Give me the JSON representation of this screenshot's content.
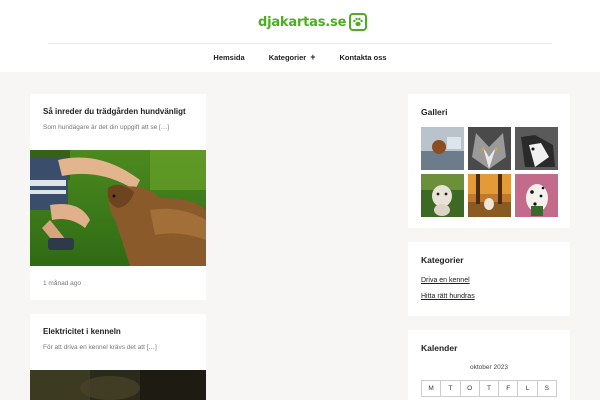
{
  "site": {
    "logo_text": "djakartas.se",
    "logo_icon": "paw-icon",
    "accent": "#4caf1f"
  },
  "nav": {
    "items": [
      {
        "label": "Hemsida"
      },
      {
        "label": "Kategorier",
        "has_submenu": true,
        "submenu_symbol": "+"
      },
      {
        "label": "Kontakta oss"
      }
    ]
  },
  "posts": [
    {
      "title": "Så inreder du trädgården hundvänligt",
      "excerpt": "Som hundägare är det din uppgift att se […]",
      "date": "1 månad ago",
      "image": "child-petting-dog-on-grass"
    },
    {
      "title": "Elektricitet i kenneln",
      "excerpt": "För att driva en kennel krävs det att […]",
      "image": "dark-forest-photo"
    }
  ],
  "sidebar": {
    "gallery": {
      "title": "Galleri",
      "thumbs": [
        "dog-in-car",
        "wolf-closeup",
        "husky-closeup",
        "white-dog-on-grass",
        "dog-in-autumn-park",
        "dalmatian-on-pink"
      ]
    },
    "categories": {
      "title": "Kategorier",
      "items": [
        "Driva en kennel",
        "Hitta rätt hundras"
      ]
    },
    "calendar": {
      "title": "Kalender",
      "caption": "oktober 2023",
      "weekdays": [
        "M",
        "T",
        "O",
        "T",
        "F",
        "L",
        "S"
      ]
    }
  }
}
